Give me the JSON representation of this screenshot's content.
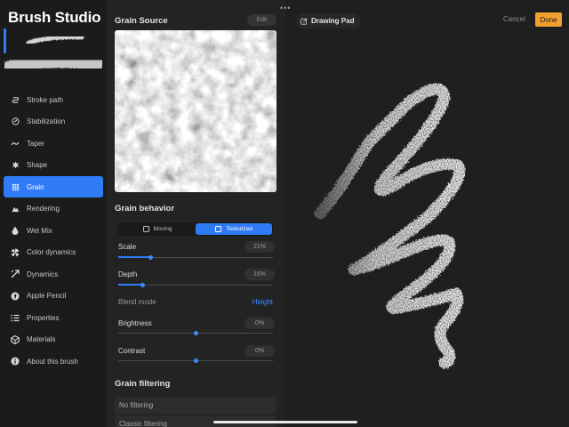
{
  "app": {
    "title": "Brush Studio"
  },
  "sidebar": {
    "items": [
      {
        "label": "Stroke path",
        "icon": "stroke-path-icon"
      },
      {
        "label": "Stabilization",
        "icon": "stabilization-icon"
      },
      {
        "label": "Taper",
        "icon": "taper-icon"
      },
      {
        "label": "Shape",
        "icon": "shape-icon"
      },
      {
        "label": "Grain",
        "icon": "grain-icon",
        "active": true
      },
      {
        "label": "Rendering",
        "icon": "rendering-icon"
      },
      {
        "label": "Wet Mix",
        "icon": "wet-mix-icon"
      },
      {
        "label": "Color dynamics",
        "icon": "color-dynamics-icon"
      },
      {
        "label": "Dynamics",
        "icon": "dynamics-icon"
      },
      {
        "label": "Apple Pencil",
        "icon": "apple-pencil-icon"
      },
      {
        "label": "Properties",
        "icon": "properties-icon"
      },
      {
        "label": "Materials",
        "icon": "materials-icon"
      },
      {
        "label": "About this brush",
        "icon": "info-icon"
      }
    ]
  },
  "grain_source": {
    "title": "Grain Source",
    "edit_label": "Edit"
  },
  "grain_behavior": {
    "title": "Grain behavior",
    "modes": [
      {
        "label": "Moving",
        "active": false
      },
      {
        "label": "Texturized",
        "active": true
      }
    ],
    "scale": {
      "label": "Scale",
      "value": "21%",
      "level": 0.21
    },
    "depth": {
      "label": "Depth",
      "value": "16%",
      "level": 0.16
    },
    "blend_mode": {
      "label": "Blend mode",
      "value": "Height"
    },
    "brightness": {
      "label": "Brightness",
      "value": "0%",
      "level": 0.5
    },
    "contrast": {
      "label": "Contrast",
      "value": "0%",
      "level": 0.5
    }
  },
  "grain_filtering": {
    "title": "Grain filtering",
    "options": [
      "No filtering",
      "Classic filtering"
    ]
  },
  "pad": {
    "title": "Drawing Pad",
    "cancel_label": "Cancel",
    "done_label": "Done",
    "more_label": "•••"
  },
  "colors": {
    "accent": "#2f7bf5",
    "done": "#f2a12e",
    "link": "#3d8bff"
  }
}
